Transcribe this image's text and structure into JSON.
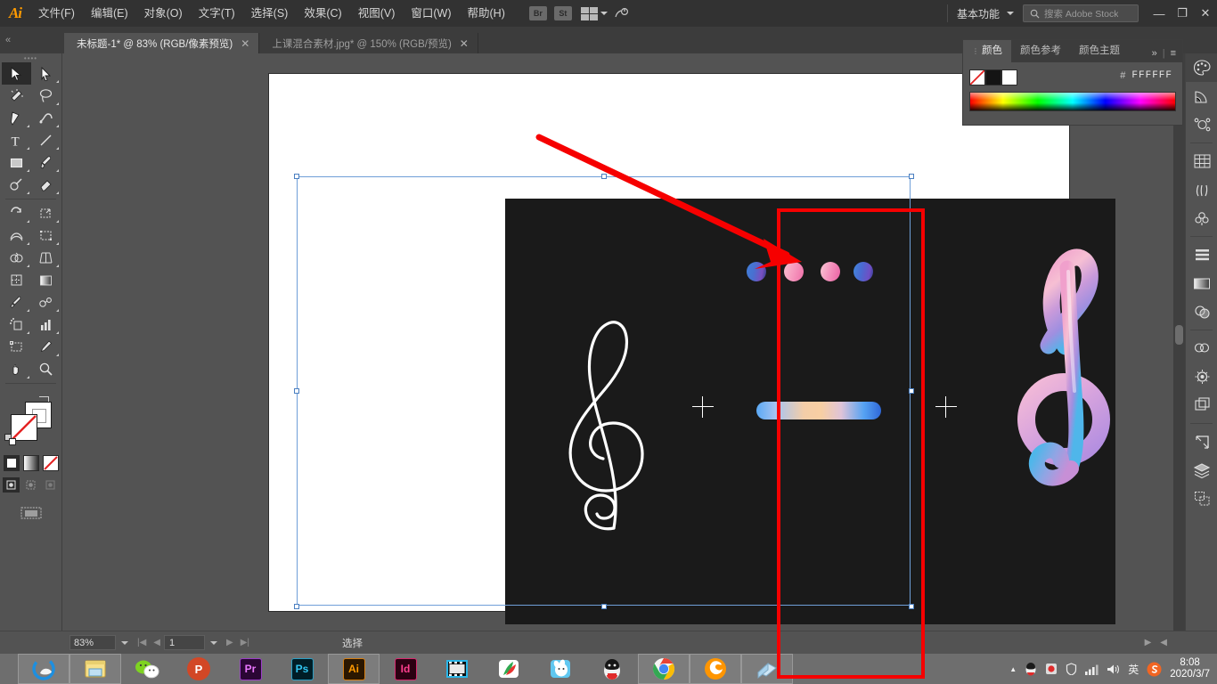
{
  "app": {
    "name": "Adobe Illustrator",
    "logo": "Ai"
  },
  "menubar": {
    "items": [
      {
        "label": "文件(F)",
        "name": "menu-file"
      },
      {
        "label": "编辑(E)",
        "name": "menu-edit"
      },
      {
        "label": "对象(O)",
        "name": "menu-object"
      },
      {
        "label": "文字(T)",
        "name": "menu-type"
      },
      {
        "label": "选择(S)",
        "name": "menu-select"
      },
      {
        "label": "效果(C)",
        "name": "menu-effect"
      },
      {
        "label": "视图(V)",
        "name": "menu-view"
      },
      {
        "label": "窗口(W)",
        "name": "menu-window"
      },
      {
        "label": "帮助(H)",
        "name": "menu-help"
      }
    ],
    "bridge_label": "Br",
    "stock_label": "St",
    "workspace": "基本功能",
    "search_placeholder": "搜索 Adobe Stock",
    "minimize": "—",
    "restore": "❐",
    "close": "✕"
  },
  "tabs": [
    {
      "title": "未标题-1* @ 83% (RGB/像素预览)",
      "close": "✕",
      "active": true
    },
    {
      "title": "上课混合素材.jpg* @ 150% (RGB/预览)",
      "close": "✕",
      "active": false
    }
  ],
  "color_panel": {
    "tabs": [
      {
        "label": "颜色",
        "active": true
      },
      {
        "label": "颜色参考",
        "active": false
      },
      {
        "label": "颜色主题",
        "active": false
      }
    ],
    "collapse_icon": "»",
    "menu_icon": "≡",
    "hex_label": "#",
    "hex_value": "FFFFFF",
    "swatches": [
      "none",
      "black",
      "white"
    ]
  },
  "toolbar": {
    "tools": [
      "selection-tool",
      "direct-selection-tool",
      "magic-wand-tool",
      "lasso-tool",
      "pen-tool",
      "curvature-tool",
      "type-tool",
      "line-segment-tool",
      "rectangle-tool",
      "paintbrush-tool",
      "shaper-tool",
      "eraser-tool",
      "rotate-tool",
      "scale-tool",
      "width-tool",
      "free-transform-tool",
      "shape-builder-tool",
      "perspective-grid-tool",
      "mesh-tool",
      "gradient-tool",
      "eyedropper-tool",
      "blend-tool",
      "symbol-sprayer-tool",
      "column-graph-tool",
      "artboard-tool",
      "slice-tool",
      "hand-tool",
      "zoom-tool"
    ],
    "selected_tool": "selection-tool",
    "fill_color": "#FFFFFF",
    "stroke_color": "none",
    "draw_modes": [
      "draw-normal",
      "draw-behind",
      "draw-inside"
    ],
    "selected_draw_mode": "draw-normal",
    "paint_modes": [
      "color-fill",
      "gradient-fill",
      "none-fill"
    ],
    "screen_mode": "change-screen-mode"
  },
  "right_dock": {
    "items": [
      "color-panel-icon",
      "color-guide-icon",
      "color-themes-icon",
      "swatches-icon",
      "brushes-icon",
      "symbols-icon",
      "align-icon",
      "gradient-icon",
      "transparency-icon",
      "cc-libraries-icon",
      "appearance-icon",
      "graphic-styles-icon",
      "transform-icon",
      "layers-icon",
      "artboards-icon"
    ],
    "selected": "color-panel-icon"
  },
  "statusbar": {
    "zoom": "83%",
    "page": "1",
    "tool_status": "选择",
    "prev_icon": "◀",
    "next_icon": "▶"
  },
  "taskbar": {
    "apps": [
      {
        "name": "taskbar-edge",
        "label": ""
      },
      {
        "name": "taskbar-file-explorer",
        "label": ""
      },
      {
        "name": "taskbar-wechat",
        "label": ""
      },
      {
        "name": "taskbar-powerpoint",
        "label": "P"
      },
      {
        "name": "taskbar-premiere",
        "label": "Pr"
      },
      {
        "name": "taskbar-photoshop",
        "label": "Ps"
      },
      {
        "name": "taskbar-illustrator",
        "label": "Ai"
      },
      {
        "name": "taskbar-indesign",
        "label": "Id"
      },
      {
        "name": "taskbar-video-editor",
        "label": ""
      },
      {
        "name": "taskbar-kugou",
        "label": ""
      },
      {
        "name": "taskbar-thunder",
        "label": ""
      },
      {
        "name": "taskbar-qq",
        "label": ""
      },
      {
        "name": "taskbar-chrome",
        "label": ""
      },
      {
        "name": "taskbar-firefox",
        "label": ""
      },
      {
        "name": "taskbar-window",
        "label": ""
      }
    ],
    "tray": {
      "show_hidden": "▲",
      "icons": [
        "qq-icon",
        "security-icon",
        "shield-icon",
        "network-icon",
        "volume-icon"
      ],
      "ime": "英",
      "sogou": "S",
      "time": "8:08",
      "date": "2020/3/7"
    }
  },
  "artwork": {
    "background_color": "#1A1A1A",
    "dots": [
      {
        "name": "dot-blue-1",
        "color": "#3F7FD8"
      },
      {
        "name": "dot-pink-1",
        "color": "#F79CC0"
      },
      {
        "name": "dot-pink-2",
        "color": "#F490BC"
      },
      {
        "name": "dot-blue-2",
        "color": "#4287DC"
      }
    ],
    "gradient_bar": "#5AA9F5 → #F3CDA8 → #2F68D8",
    "plus_left": "+",
    "plus_right": "+",
    "clef_outline_color": "#FFFFFF",
    "clef_gradient_colors": [
      "#F0A8D0",
      "#C68BD8",
      "#4FB8E8"
    ]
  },
  "annotations": {
    "rect_color": "#F60000",
    "arrow_color": "#F60000"
  }
}
